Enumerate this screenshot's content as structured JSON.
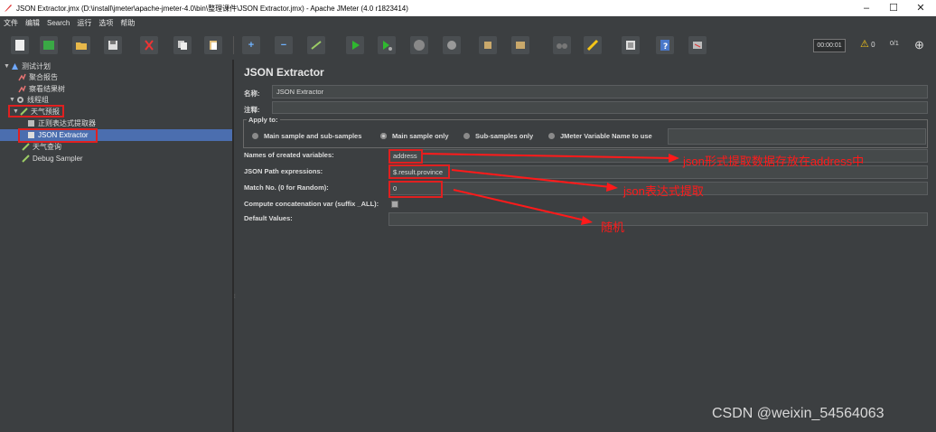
{
  "window": {
    "title": "JSON Extractor.jmx (D:\\install\\jmeter\\apache-jmeter-4.0\\bin\\整理课件\\JSON Extractor.jmx) - Apache JMeter (4.0 r1823414)",
    "minimize": "–",
    "maximize": "☐",
    "close": "✕"
  },
  "menu": [
    "文件",
    "编辑",
    "Search",
    "运行",
    "选项",
    "帮助"
  ],
  "toolbar": {
    "timer": "00:00:01",
    "warning_count": "0",
    "threads": "0/1"
  },
  "tree": {
    "items": [
      {
        "label": "测试计划",
        "icon": "test-plan-icon"
      },
      {
        "label": "聚合报告",
        "icon": "listener-icon"
      },
      {
        "label": "察看结果树",
        "icon": "listener-icon"
      },
      {
        "label": "线程组",
        "icon": "thread-group-icon"
      },
      {
        "label": "天气预报",
        "icon": "sampler-icon"
      },
      {
        "label": "正则表达式提取器",
        "icon": "extractor-icon"
      },
      {
        "label": "JSON Extractor",
        "icon": "extractor-icon"
      },
      {
        "label": "天气查询",
        "icon": "sampler-icon"
      },
      {
        "label": "Debug Sampler",
        "icon": "sampler-icon"
      }
    ]
  },
  "panel": {
    "title": "JSON Extractor",
    "name_label": "名称:",
    "name_value": "JSON Extractor",
    "comment_label": "注释:",
    "apply_to": "Apply to:",
    "radios": [
      {
        "label": "Main sample and sub-samples",
        "selected": false
      },
      {
        "label": "Main sample only",
        "selected": true
      },
      {
        "label": "Sub-samples only",
        "selected": false
      },
      {
        "label": "JMeter Variable Name to use",
        "selected": false
      }
    ],
    "var_names_label": "Names of created variables:",
    "var_names_value": "address",
    "json_path_label": "JSON Path expressions:",
    "json_path_value": "$.result.province",
    "match_no_label": "Match No. (0 for Random):",
    "match_no_value": "0",
    "concat_label": "Compute concatenation var (suffix _ALL):",
    "default_label": "Default Values:"
  },
  "annotations": {
    "a1": "json形式提取数据存放在address中",
    "a2": "json表达式提取",
    "a3": "随机",
    "color": "#ff1a1a"
  },
  "watermark": "CSDN @weixin_54564063"
}
